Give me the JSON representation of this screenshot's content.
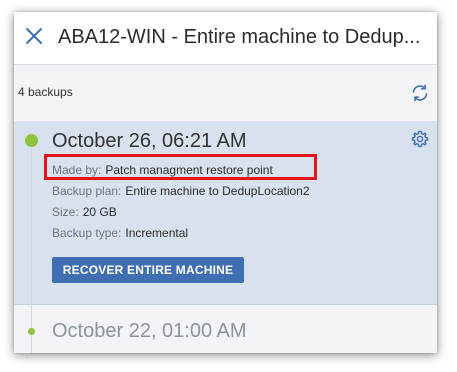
{
  "header": {
    "title": "ABA12-WIN - Entire machine to Dedup...",
    "close_icon": "close-icon"
  },
  "subbar": {
    "count_text": "4 backups",
    "refresh_icon": "refresh-icon"
  },
  "selected_backup": {
    "date": "October 26, 06:21 AM",
    "settings_icon": "gear-icon",
    "made_by_label": "Made by:",
    "made_by_value": "Patch managment restore point",
    "plan_label": "Backup plan:",
    "plan_value": "Entire machine to DedupLocation2",
    "size_label": "Size:",
    "size_value": "20 GB",
    "type_label": "Backup type:",
    "type_value": "Incremental",
    "recover_button": "RECOVER ENTIRE MACHINE"
  },
  "next_backup": {
    "date": "October 22, 01:00 AM"
  },
  "colors": {
    "accent": "#3f6fb2",
    "status_ok": "#8fc33a",
    "highlight": "#e8141c",
    "selected_bg": "#d8e2ee"
  }
}
